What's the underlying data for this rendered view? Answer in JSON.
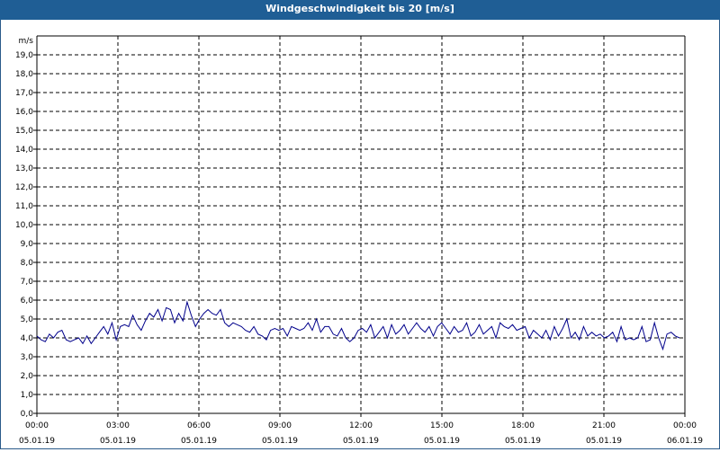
{
  "chart_data": {
    "type": "line",
    "title": "Windgeschwindigkeit bis 20 [m/s]",
    "ylabel": "m/s",
    "ylim": [
      0,
      20
    ],
    "yticks": [
      "0,0",
      "1,0",
      "2,0",
      "3,0",
      "4,0",
      "5,0",
      "6,0",
      "7,0",
      "8,0",
      "9,0",
      "10,0",
      "11,0",
      "12,0",
      "13,0",
      "14,0",
      "15,0",
      "16,0",
      "17,0",
      "18,0",
      "19,0"
    ],
    "xticks": [
      {
        "time": "00:00",
        "date": "05.01.19"
      },
      {
        "time": "03:00",
        "date": "05.01.19"
      },
      {
        "time": "06:00",
        "date": "05.01.19"
      },
      {
        "time": "09:00",
        "date": "05.01.19"
      },
      {
        "time": "12:00",
        "date": "05.01.19"
      },
      {
        "time": "15:00",
        "date": "05.01.19"
      },
      {
        "time": "18:00",
        "date": "05.01.19"
      },
      {
        "time": "21:00",
        "date": "05.01.19"
      },
      {
        "time": "00:00",
        "date": "06.01.19"
      }
    ],
    "grid": true,
    "line_color": "#00008b",
    "series": [
      {
        "values": [
          4.1,
          3.9,
          3.8,
          4.2,
          4.0,
          4.3,
          4.4,
          3.9,
          3.8,
          3.9,
          4.0,
          3.7,
          4.1,
          3.7,
          4.0,
          4.3,
          4.6,
          4.2,
          4.8,
          3.9,
          4.6,
          4.7,
          4.6,
          5.2,
          4.7,
          4.4,
          4.9,
          5.3,
          5.1,
          5.5,
          4.9,
          5.6,
          5.5,
          4.8,
          5.3,
          4.9,
          5.9,
          5.2,
          4.6,
          5.0,
          5.3,
          5.5,
          5.3,
          5.2,
          5.5,
          4.8,
          4.6,
          4.8,
          4.7,
          4.6,
          4.4,
          4.3,
          4.6,
          4.2,
          4.1,
          3.9,
          4.4,
          4.5,
          4.4,
          4.5,
          4.1,
          4.6,
          4.5,
          4.4,
          4.5,
          4.8,
          4.4,
          5.0,
          4.3,
          4.6,
          4.6,
          4.2,
          4.1,
          4.5,
          4.0,
          3.8,
          4.0,
          4.4,
          4.5,
          4.3,
          4.7,
          4.0,
          4.3,
          4.6,
          4.0,
          4.7,
          4.2,
          4.4,
          4.7,
          4.2,
          4.5,
          4.8,
          4.5,
          4.3,
          4.6,
          4.1,
          4.6,
          4.8,
          4.5,
          4.2,
          4.6,
          4.3,
          4.4,
          4.8,
          4.1,
          4.3,
          4.7,
          4.2,
          4.4,
          4.6,
          4.0,
          4.8,
          4.6,
          4.5,
          4.7,
          4.4,
          4.5,
          4.6,
          4.0,
          4.4,
          4.2,
          4.0,
          4.4,
          3.9,
          4.6,
          4.1,
          4.5,
          5.0,
          4.0,
          4.3,
          3.9,
          4.6,
          4.1,
          4.3,
          4.1,
          4.2,
          4.0,
          4.1,
          4.3,
          3.8,
          4.6,
          3.9,
          4.0,
          3.9,
          4.0,
          4.6,
          3.8,
          3.9,
          4.8,
          4.0,
          3.4,
          4.2,
          4.3,
          4.1,
          4.0
        ]
      }
    ]
  }
}
